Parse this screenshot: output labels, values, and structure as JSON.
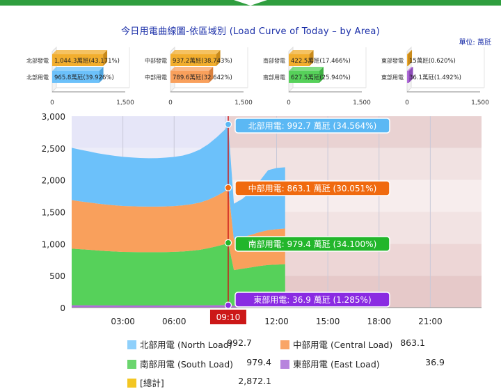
{
  "header": {
    "title": "今日用電曲線圖-依區域別 (Load Curve of Today – by Area)",
    "unit": "單位: 萬瓩"
  },
  "colors": {
    "north": "#6cc1fa",
    "central": "#f9a05c",
    "south": "#56d15a",
    "east": "#b06ad9",
    "total": "#f3c623",
    "gen": "#f2ae2e",
    "cursor": "#cc1818"
  },
  "chart_data": [
    {
      "type": "bar",
      "title": "北部",
      "categories": [
        "北部發電",
        "北部用電"
      ],
      "values": [
        1044.3,
        965.8
      ],
      "labels": [
        "1,044.3萬瓩(43.171%)",
        "965.8萬瓩(39.926%)"
      ],
      "xticks": [
        "0",
        "1,500"
      ],
      "xlim": [
        0,
        1500
      ]
    },
    {
      "type": "bar",
      "title": "中部",
      "categories": [
        "中部發電",
        "中部用電"
      ],
      "values": [
        937.2,
        789.6
      ],
      "labels": [
        "937.2萬瓩(38.743%)",
        "789.6萬瓩(32.642%)"
      ],
      "xticks": [
        "0",
        "1,500"
      ],
      "xlim": [
        0,
        1500
      ]
    },
    {
      "type": "bar",
      "title": "南部",
      "categories": [
        "南部發電",
        "南部用電"
      ],
      "values": [
        422.5,
        627.5
      ],
      "labels": [
        "422.5萬瓩(17.466%)",
        "627.5萬瓩(25.940%)"
      ],
      "xticks": [
        "0",
        "1,500"
      ],
      "xlim": [
        0,
        1500
      ]
    },
    {
      "type": "bar",
      "title": "東部",
      "categories": [
        "東部發電",
        "東部用電"
      ],
      "values": [
        15,
        36.1
      ],
      "labels": [
        "15萬瓩(0.620%)",
        "36.1萬瓩(1.492%)"
      ],
      "xticks": [
        "0",
        "1,500"
      ],
      "xlim": [
        0,
        1500
      ]
    },
    {
      "type": "area",
      "stacked": true,
      "x": [
        "00:00",
        "00:30",
        "01:00",
        "01:30",
        "02:00",
        "02:30",
        "03:00",
        "03:30",
        "04:00",
        "04:30",
        "05:00",
        "05:30",
        "06:00",
        "06:30",
        "07:00",
        "07:30",
        "08:00",
        "08:30",
        "09:00",
        "09:10",
        "09:30",
        "10:00",
        "10:30",
        "11:00",
        "11:30",
        "12:00",
        "12:30"
      ],
      "xticks": [
        "03:00",
        "06:00",
        "09:00",
        "12:00",
        "15:00",
        "18:00",
        "21:00"
      ],
      "xlim": [
        "00:00",
        "24:00"
      ],
      "ylim": [
        0,
        3000
      ],
      "yticks": [
        "0",
        "500",
        "1,000",
        "1,500",
        "2,000",
        "2,500",
        "3,000"
      ],
      "series": [
        {
          "name": "東部用電",
          "values": [
            35,
            35,
            35,
            34,
            34,
            34,
            33,
            33,
            33,
            33,
            33,
            34,
            34,
            35,
            35,
            36,
            36,
            37,
            37,
            36.9,
            28,
            29,
            30,
            32,
            33,
            34,
            35
          ]
        },
        {
          "name": "南部用電",
          "values": [
            890,
            880,
            872,
            862,
            852,
            845,
            840,
            838,
            836,
            836,
            836,
            836,
            840,
            845,
            855,
            870,
            895,
            925,
            960,
            979.4,
            560,
            580,
            600,
            620,
            635,
            640,
            645
          ]
        },
        {
          "name": "中部用電",
          "values": [
            760,
            750,
            742,
            735,
            730,
            725,
            720,
            718,
            716,
            714,
            714,
            716,
            718,
            722,
            730,
            740,
            760,
            790,
            830,
            863.1,
            480,
            495,
            510,
            530,
            545,
            555,
            560
          ]
        },
        {
          "name": "北部用電",
          "values": [
            820,
            810,
            800,
            790,
            782,
            775,
            770,
            765,
            760,
            758,
            760,
            765,
            770,
            780,
            800,
            830,
            870,
            920,
            970,
            992.7,
            560,
            600,
            680,
            800,
            940,
            960,
            960
          ]
        }
      ],
      "cursor": {
        "label": "09:10",
        "x": "09:10"
      },
      "tooltips": [
        {
          "name": "north",
          "text": "北部用電: 992.7 萬瓩 (34.564%)"
        },
        {
          "name": "central",
          "text": "中部用電: 863.1 萬瓩 (30.051%)"
        },
        {
          "name": "south",
          "text": "南部用電: 979.4 萬瓩 (34.100%)"
        },
        {
          "name": "east",
          "text": "東部用電: 36.9 萬瓩 (1.285%)"
        }
      ]
    }
  ],
  "legend": {
    "north": {
      "label": "北部用電 (North Load)",
      "value": "992.7"
    },
    "central": {
      "label": "中部用電 (Central Load)",
      "value": "863.1"
    },
    "south": {
      "label": "南部用電 (South Load)",
      "value": "979.4"
    },
    "east": {
      "label": "東部用電 (East Load)",
      "value": "36.9"
    },
    "total": {
      "label": "[總計]",
      "value": "2,872.1"
    }
  }
}
